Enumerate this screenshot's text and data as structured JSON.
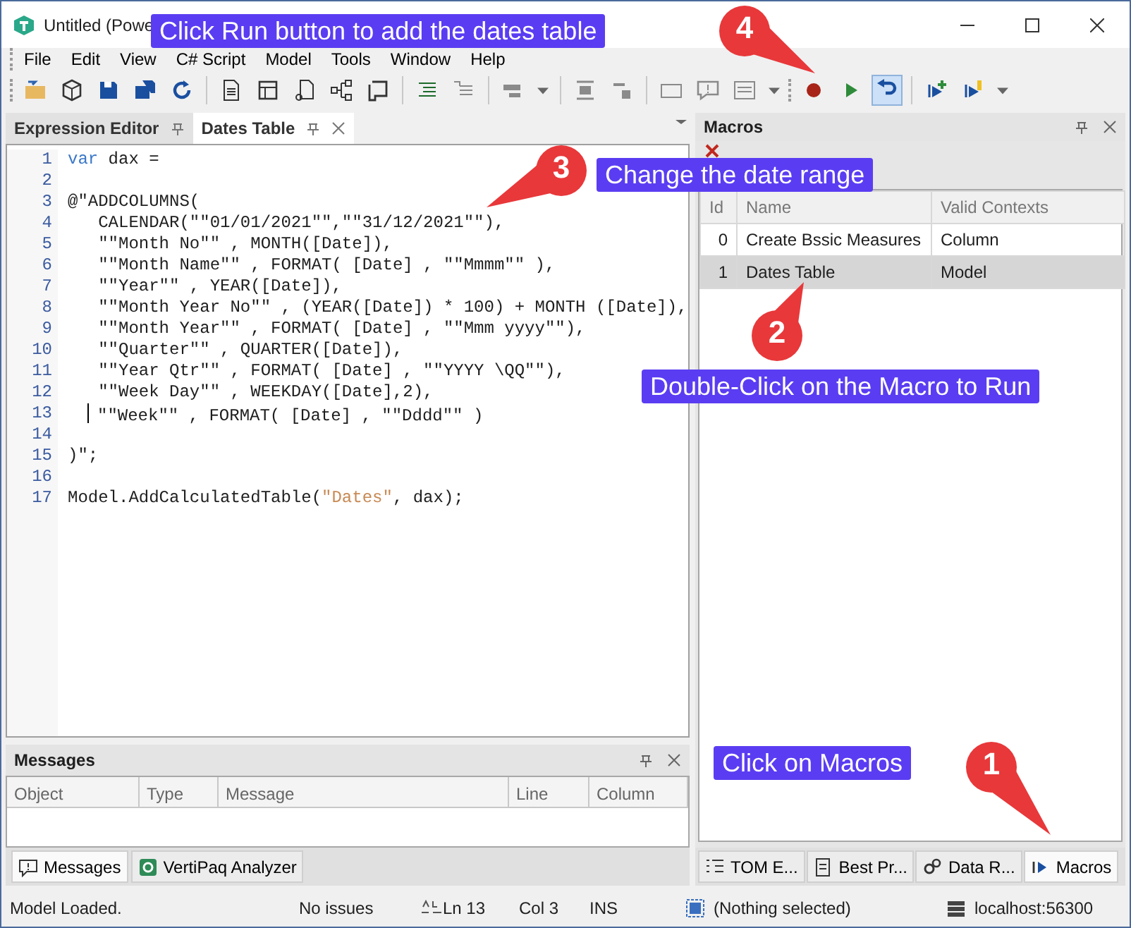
{
  "window": {
    "title": "Untitled (Powe"
  },
  "menu": [
    "File",
    "Edit",
    "View",
    "C# Script",
    "Model",
    "Tools",
    "Window",
    "Help"
  ],
  "editor": {
    "tabs": [
      {
        "label": "Expression Editor",
        "selected": false
      },
      {
        "label": "Dates Table",
        "selected": true
      }
    ],
    "lines": [
      {
        "number": "1",
        "cursor": false,
        "segments": [
          {
            "kind": "keyword",
            "text": "var"
          },
          {
            "kind": "plain",
            "text": " dax ="
          }
        ]
      },
      {
        "number": "2",
        "cursor": false
      },
      {
        "number": "3",
        "cursor": false,
        "segments": [
          {
            "kind": "plain",
            "text": "@\"ADDCOLUMNS("
          }
        ]
      },
      {
        "number": "4",
        "cursor": false,
        "segments": [
          {
            "kind": "plain",
            "text": "   CALENDAR(\"\"01/01/2021\"\",\"\"31/12/2021\"\"),"
          }
        ]
      },
      {
        "number": "5",
        "cursor": false,
        "segments": [
          {
            "kind": "plain",
            "text": "   \"\"Month No\"\" , MONTH([Date]),"
          }
        ]
      },
      {
        "number": "6",
        "cursor": false,
        "segments": [
          {
            "kind": "plain",
            "text": "   \"\"Month Name\"\" , FORMAT( [Date] , \"\"Mmmm\"\" ),"
          }
        ]
      },
      {
        "number": "7",
        "cursor": false,
        "segments": [
          {
            "kind": "plain",
            "text": "   \"\"Year\"\" , YEAR([Date]),"
          }
        ]
      },
      {
        "number": "8",
        "cursor": false,
        "segments": [
          {
            "kind": "plain",
            "text": "   \"\"Month Year No\"\" , (YEAR([Date]) * 100) + MONTH ([Date]),"
          }
        ]
      },
      {
        "number": "9",
        "cursor": false,
        "segments": [
          {
            "kind": "plain",
            "text": "   \"\"Month Year\"\" , FORMAT( [Date] , \"\"Mmm yyyy\"\"),"
          }
        ]
      },
      {
        "number": "10",
        "cursor": false,
        "segments": [
          {
            "kind": "plain",
            "text": "   \"\"Quarter\"\" , QUARTER([Date]),"
          }
        ]
      },
      {
        "number": "11",
        "cursor": false,
        "segments": [
          {
            "kind": "plain",
            "text": "   \"\"Year Qtr\"\" , FORMAT( [Date] , \"\"YYYY \\QQ\"\"),"
          }
        ]
      },
      {
        "number": "12",
        "cursor": false,
        "segments": [
          {
            "kind": "plain",
            "text": "   \"\"Week Day\"\" , WEEKDAY([Date],2),"
          }
        ]
      },
      {
        "number": "13",
        "cursor": true,
        "segments": [
          {
            "kind": "plain",
            "text": "\"\"Week\"\" , FORMAT( [Date] , \"\"Dddd\"\" )"
          }
        ]
      },
      {
        "number": "14",
        "cursor": false
      },
      {
        "number": "15",
        "cursor": false,
        "segments": [
          {
            "kind": "plain",
            "text": ")\";"
          }
        ]
      },
      {
        "number": "16",
        "cursor": false
      },
      {
        "number": "17",
        "cursor": false,
        "segments": [
          {
            "kind": "plain",
            "text": "Model.AddCalculatedTable("
          },
          {
            "kind": "string",
            "text": "\"Dates\""
          },
          {
            "kind": "plain",
            "text": ", dax);"
          }
        ]
      }
    ]
  },
  "messages": {
    "title": "Messages",
    "columns": [
      "Object",
      "Type",
      "Message",
      "Line",
      "Column"
    ],
    "tabs": [
      {
        "label": "Messages",
        "selected": true
      },
      {
        "label": "VertiPaq Analyzer",
        "selected": false
      }
    ]
  },
  "macros": {
    "title": "Macros",
    "columns": [
      "Id",
      "Name",
      "Valid Contexts"
    ],
    "rows": [
      {
        "id": "0",
        "name": "Create Bssic Measures",
        "context": "Column",
        "selected": false
      },
      {
        "id": "1",
        "name": "Dates Table",
        "context": "Model",
        "selected": true
      }
    ],
    "tabs": [
      {
        "label": "TOM E...",
        "selected": false
      },
      {
        "label": "Best Pr...",
        "selected": false
      },
      {
        "label": "Data R...",
        "selected": false
      },
      {
        "label": "Macros",
        "selected": true
      }
    ]
  },
  "status_bar": {
    "message": "Model Loaded.",
    "issues": "No issues",
    "line": "Ln 13",
    "column": "Col 3",
    "mode": "INS",
    "selection": "(Nothing selected)",
    "server": "localhost:56300"
  },
  "callouts": [
    {
      "number": "4",
      "text": "Click Run button to add the dates table"
    },
    {
      "number": "3",
      "text": "Change the date range"
    },
    {
      "number": "2",
      "text": "Double-Click on the Macro to Run"
    },
    {
      "number": "1",
      "text": "Click on Macros"
    }
  ]
}
